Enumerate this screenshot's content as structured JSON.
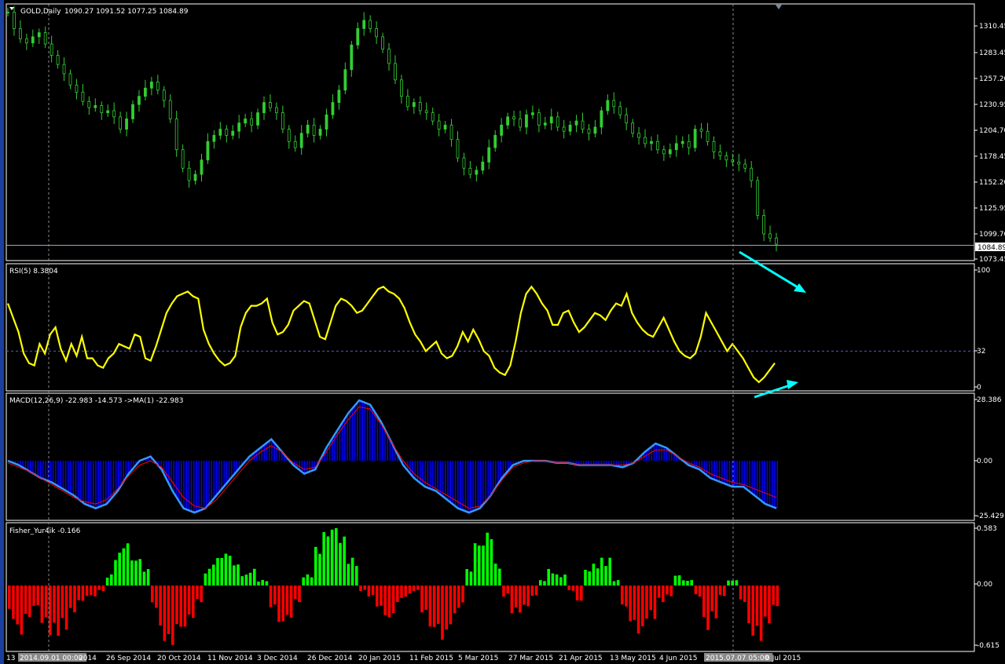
{
  "symbol_header": {
    "symbol": "GOLD,Daily",
    "ohlc": "1090.27 1091.52 1077.25 1084.89"
  },
  "colors": {
    "background": "#000000",
    "border": "#ffffff",
    "price_candles": "#32cd32",
    "rsi_line": "#ffff00",
    "macd_hist": "#0000ff",
    "macd_line": "#3399ff",
    "macd_signal": "#ff0000",
    "fisher_up": "#00ff00",
    "fisher_down": "#ff0000",
    "grid_sep": "#6a6a6a",
    "arrows": "#00ffff",
    "level_line": "#5a5ac8"
  },
  "chart_data": [
    {
      "type": "candlestick",
      "title": "GOLD,Daily",
      "last_price_label": "1084.89",
      "y_ticks": [
        "1310.45",
        "1283.45",
        "1257.20",
        "1230.95",
        "1204.70",
        "1178.45",
        "1152.20",
        "1125.95",
        "1099.70",
        "1073.45"
      ],
      "ylim": [
        1070,
        1320
      ],
      "x_ticks": [
        "13",
        "2014.09.01 00:00",
        "2014",
        "26 Sep 2014",
        "20 Oct 2014",
        "11 Nov 2014",
        "3 Dec 2014",
        "26 Dec 2014",
        "20 Jan 2015",
        "11 Feb 2015",
        "5 Mar 2015",
        "27 Mar 2015",
        "21 Apr 2015",
        "13 May 2015",
        "4 Jun 2015",
        "2015.07.07 05:00",
        "0 Jul 2015"
      ],
      "close_path": [
        1312,
        1296,
        1286,
        1282,
        1288,
        1292,
        1281,
        1270,
        1261,
        1252,
        1241,
        1234,
        1225,
        1219,
        1221,
        1214,
        1216,
        1210,
        1198,
        1208,
        1222,
        1230,
        1238,
        1244,
        1236,
        1226,
        1208,
        1178,
        1160,
        1148,
        1154,
        1168,
        1186,
        1192,
        1198,
        1192,
        1196,
        1204,
        1208,
        1202,
        1214,
        1224,
        1219,
        1214,
        1198,
        1186,
        1180,
        1194,
        1202,
        1192,
        1198,
        1212,
        1224,
        1236,
        1256,
        1280,
        1296,
        1304,
        1296,
        1288,
        1276,
        1262,
        1246,
        1230,
        1220,
        1224,
        1216,
        1214,
        1206,
        1198,
        1202,
        1188,
        1170,
        1160,
        1154,
        1158,
        1166,
        1180,
        1192,
        1202,
        1210,
        1208,
        1200,
        1212,
        1214,
        1202,
        1204,
        1210,
        1200,
        1196,
        1202,
        1206,
        1198,
        1194,
        1200,
        1216,
        1226,
        1220,
        1212,
        1204,
        1194,
        1190,
        1184,
        1186,
        1178,
        1174,
        1178,
        1184,
        1186,
        1180,
        1198,
        1196,
        1186,
        1176,
        1172,
        1168,
        1166,
        1164,
        1160,
        1148,
        1114,
        1096,
        1092,
        1086
      ]
    },
    {
      "type": "line",
      "title": "RSI(5) 8.3804",
      "y_ticks": [
        "100",
        "32",
        "0"
      ],
      "level": 32,
      "ylim": [
        0,
        100
      ],
      "values": [
        72,
        60,
        48,
        30,
        22,
        20,
        38,
        30,
        46,
        52,
        34,
        24,
        38,
        28,
        44,
        26,
        26,
        20,
        18,
        26,
        30,
        38,
        36,
        34,
        46,
        44,
        26,
        24,
        36,
        50,
        64,
        72,
        78,
        80,
        82,
        78,
        76,
        50,
        38,
        30,
        24,
        20,
        22,
        28,
        52,
        64,
        70,
        70,
        72,
        76,
        56,
        46,
        48,
        54,
        66,
        70,
        74,
        72,
        58,
        44,
        42,
        56,
        70,
        76,
        74,
        70,
        64,
        66,
        72,
        78,
        84,
        86,
        82,
        80,
        76,
        68,
        56,
        46,
        40,
        32,
        36,
        40,
        30,
        26,
        28,
        36,
        48,
        40,
        50,
        42,
        32,
        28,
        18,
        14,
        12,
        20,
        40,
        64,
        80,
        86,
        80,
        72,
        66,
        54,
        54,
        64,
        66,
        56,
        48,
        52,
        58,
        64,
        62,
        58,
        66,
        72,
        70,
        80,
        64,
        56,
        50,
        46,
        44,
        52,
        60,
        50,
        40,
        32,
        28,
        26,
        30,
        44,
        64,
        56,
        48,
        40,
        32,
        38,
        32,
        26,
        18,
        10,
        6,
        10,
        16,
        22
      ]
    },
    {
      "type": "histogram+lines",
      "title": "MACD(12,26,9) -22.983 -14.573  ->MA(1) -22.983",
      "y_ticks": [
        "28.386",
        "0.00",
        "-25.429"
      ],
      "ylim": [
        -25.429,
        28.386
      ],
      "values": [
        0,
        -2,
        -5,
        -8,
        -10,
        -13,
        -16,
        -20,
        -22,
        -20,
        -14,
        -6,
        0,
        2,
        -4,
        -14,
        -22,
        -24,
        -22,
        -16,
        -10,
        -4,
        2,
        6,
        10,
        4,
        -2,
        -6,
        -4,
        6,
        14,
        22,
        28,
        26,
        18,
        8,
        -2,
        -8,
        -12,
        -14,
        -18,
        -22,
        -24,
        -22,
        -16,
        -8,
        -2,
        0,
        0,
        0,
        -1,
        -1,
        -2,
        -2,
        -2,
        -2,
        -3,
        -1,
        4,
        8,
        6,
        2,
        -2,
        -4,
        -8,
        -10,
        -12,
        -12,
        -16,
        -20,
        -22
      ],
      "signal": [
        -1,
        -3,
        -5,
        -8,
        -11,
        -14,
        -17,
        -19,
        -20,
        -18,
        -13,
        -7,
        -2,
        0,
        -3,
        -10,
        -17,
        -21,
        -22,
        -18,
        -12,
        -6,
        0,
        4,
        7,
        4,
        -1,
        -4,
        -3,
        4,
        12,
        19,
        25,
        24,
        17,
        8,
        0,
        -6,
        -10,
        -13,
        -16,
        -19,
        -22,
        -21,
        -16,
        -9,
        -3,
        -1,
        0,
        0,
        -1,
        -1,
        -2,
        -2,
        -2,
        -2,
        -2,
        -1,
        2,
        5,
        5,
        2,
        -1,
        -3,
        -6,
        -8,
        -10,
        -11,
        -13,
        -15,
        -17
      ]
    },
    {
      "type": "bar",
      "title": "Fisher_Yur4ik -0.166",
      "y_ticks": [
        "0.583",
        "0.00",
        "-0.615"
      ],
      "ylim": [
        -0.615,
        0.583
      ],
      "values": [
        -0.3,
        -0.45,
        -0.3,
        -0.2,
        -0.35,
        -0.45,
        -0.4,
        -0.25,
        -0.15,
        -0.1,
        -0.05,
        0.1,
        0.3,
        0.4,
        0.25,
        0.15,
        -0.2,
        -0.5,
        -0.55,
        -0.4,
        -0.3,
        -0.15,
        0.15,
        0.25,
        0.3,
        0.2,
        0.1,
        0.15,
        0.05,
        -0.2,
        -0.35,
        -0.3,
        -0.15,
        0.1,
        0.35,
        0.5,
        0.55,
        0.45,
        0.25,
        -0.05,
        -0.1,
        -0.2,
        -0.3,
        -0.15,
        -0.1,
        -0.05,
        -0.25,
        -0.4,
        -0.5,
        -0.35,
        -0.2,
        0.15,
        0.4,
        0.5,
        0.2,
        -0.1,
        -0.25,
        -0.2,
        -0.1,
        0.05,
        0.15,
        0.1,
        -0.05,
        -0.15,
        0.15,
        0.2,
        0.25,
        0.05,
        -0.2,
        -0.35,
        -0.45,
        -0.3,
        -0.15,
        -0.1,
        0.1,
        0.05,
        -0.1,
        -0.4,
        -0.3,
        -0.1,
        0.05,
        -0.15,
        -0.45,
        -0.5,
        -0.35,
        -0.2
      ]
    }
  ]
}
